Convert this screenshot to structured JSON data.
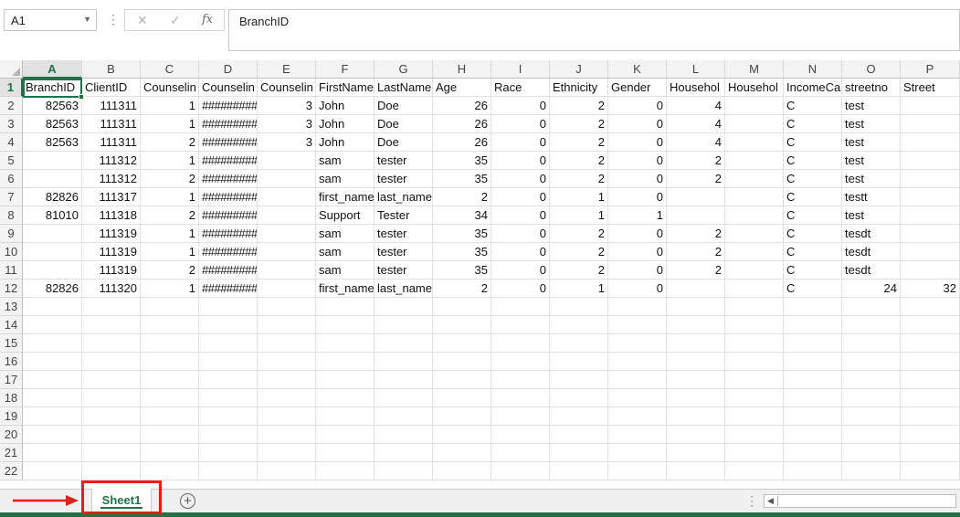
{
  "name_box": {
    "value": "A1",
    "dropdown_icon": "chevron-down-icon"
  },
  "formula_bar": {
    "cancel_icon": "close-icon",
    "enter_icon": "checkmark-icon",
    "fx_label": "fx",
    "content": "BranchID"
  },
  "columns": [
    "A",
    "B",
    "C",
    "D",
    "E",
    "F",
    "G",
    "H",
    "I",
    "J",
    "K",
    "L",
    "M",
    "N",
    "O",
    "P"
  ],
  "rows": [
    "1",
    "2",
    "3",
    "4",
    "5",
    "6",
    "7",
    "8",
    "9",
    "10",
    "11",
    "12",
    "13",
    "14",
    "15",
    "16",
    "17",
    "18",
    "19",
    "20",
    "21",
    "22"
  ],
  "cells": [
    [
      "BranchID",
      "ClientID",
      "Counselin",
      "Counselin",
      "Counselin",
      "FirstName",
      "LastName",
      "Age",
      "Race",
      "Ethnicity",
      "Gender",
      "Househol",
      "Househol",
      "IncomeCa",
      "streetno",
      "Street"
    ],
    [
      "82563",
      "111311",
      "1",
      "#########",
      "3",
      "John",
      "Doe",
      "26",
      "0",
      "2",
      "0",
      "4",
      "",
      "C",
      "test",
      ""
    ],
    [
      "82563",
      "111311",
      "1",
      "#########",
      "3",
      "John",
      "Doe",
      "26",
      "0",
      "2",
      "0",
      "4",
      "",
      "C",
      "test",
      ""
    ],
    [
      "82563",
      "111311",
      "2",
      "#########",
      "3",
      "John",
      "Doe",
      "26",
      "0",
      "2",
      "0",
      "4",
      "",
      "C",
      "test",
      ""
    ],
    [
      "",
      "111312",
      "1",
      "#########",
      "",
      "sam",
      "tester",
      "35",
      "0",
      "2",
      "0",
      "2",
      "",
      "C",
      "test",
      ""
    ],
    [
      "",
      "111312",
      "2",
      "#########",
      "",
      "sam",
      "tester",
      "35",
      "0",
      "2",
      "0",
      "2",
      "",
      "C",
      "test",
      ""
    ],
    [
      "82826",
      "111317",
      "1",
      "#########",
      "",
      "first_name",
      "last_name",
      "2",
      "0",
      "1",
      "0",
      "",
      "",
      "C",
      "testt",
      ""
    ],
    [
      "81010",
      "111318",
      "2",
      "#########",
      "",
      "Support",
      "Tester",
      "34",
      "0",
      "1",
      "1",
      "",
      "",
      "C",
      "test",
      ""
    ],
    [
      "",
      "111319",
      "1",
      "#########",
      "",
      "sam",
      "tester",
      "35",
      "0",
      "2",
      "0",
      "2",
      "",
      "C",
      "tesdt",
      ""
    ],
    [
      "",
      "111319",
      "1",
      "#########",
      "",
      "sam",
      "tester",
      "35",
      "0",
      "2",
      "0",
      "2",
      "",
      "C",
      "tesdt",
      ""
    ],
    [
      "",
      "111319",
      "2",
      "#########",
      "",
      "sam",
      "tester",
      "35",
      "0",
      "2",
      "0",
      "2",
      "",
      "C",
      "tesdt",
      ""
    ],
    [
      "82826",
      "111320",
      "1",
      "#########",
      "",
      "first_name",
      "last_name",
      "2",
      "0",
      "1",
      "0",
      "",
      "",
      "C",
      "24",
      "32"
    ]
  ],
  "sheet_tabs": [
    {
      "label": "Sheet1",
      "active": true
    }
  ],
  "add_sheet_icon": "plus-circle-icon",
  "colors": {
    "accent": "#217346",
    "callout": "#e0201a"
  }
}
